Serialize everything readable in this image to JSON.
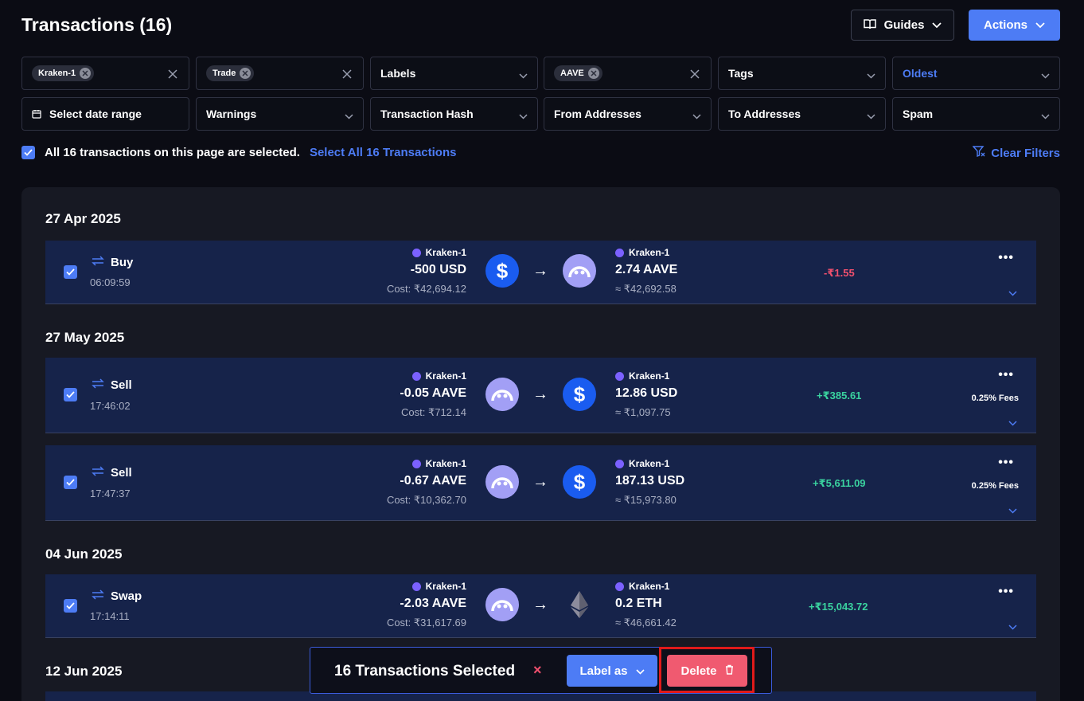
{
  "header": {
    "title": "Transactions (16)",
    "guides_label": "Guides",
    "actions_label": "Actions"
  },
  "filters": {
    "exchange_chip": "Kraken-1",
    "type_chip": "Trade",
    "labels": "Labels",
    "asset_chip": "AAVE",
    "tags": "Tags",
    "sort": "Oldest",
    "date_range": "Select date range",
    "warnings": "Warnings",
    "tx_hash": "Transaction Hash",
    "from_addresses": "From Addresses",
    "to_addresses": "To Addresses",
    "spam": "Spam"
  },
  "selection": {
    "text": "All 16 transactions on this page are selected.",
    "select_all_link": "Select All 16 Transactions",
    "clear_filters": "Clear Filters"
  },
  "groups": [
    {
      "date": "27 Apr 2025",
      "rows": [
        {
          "type": "Buy",
          "time": "06:09:59",
          "from_src": "Kraken-1",
          "from_amount": "-500 USD",
          "from_cost": "Cost: ₹42,694.12",
          "to_src": "Kraken-1",
          "to_amount": "2.74 AAVE",
          "to_value": "≈ ₹42,692.58",
          "pnl": "-₹1.55",
          "fees": ""
        }
      ]
    },
    {
      "date": "27 May 2025",
      "rows": [
        {
          "type": "Sell",
          "time": "17:46:02",
          "from_src": "Kraken-1",
          "from_amount": "-0.05 AAVE",
          "from_cost": "Cost: ₹712.14",
          "to_src": "Kraken-1",
          "to_amount": "12.86 USD",
          "to_value": "≈ ₹1,097.75",
          "pnl": "+₹385.61",
          "fees": "0.25% Fees"
        },
        {
          "type": "Sell",
          "time": "17:47:37",
          "from_src": "Kraken-1",
          "from_amount": "-0.67 AAVE",
          "from_cost": "Cost: ₹10,362.70",
          "to_src": "Kraken-1",
          "to_amount": "187.13 USD",
          "to_value": "≈ ₹15,973.80",
          "pnl": "+₹5,611.09",
          "fees": "0.25% Fees"
        }
      ]
    },
    {
      "date": "04 Jun 2025",
      "rows": [
        {
          "type": "Swap",
          "time": "17:14:11",
          "from_src": "Kraken-1",
          "from_amount": "-2.03 AAVE",
          "from_cost": "Cost: ₹31,617.69",
          "to_src": "Kraken-1",
          "to_amount": "0.2 ETH",
          "to_value": "≈ ₹46,661.42",
          "pnl": "+₹15,043.72",
          "fees": ""
        }
      ]
    },
    {
      "date": "12 Jun 2025",
      "rows": []
    }
  ],
  "bulk_bar": {
    "text": "16 Transactions Selected",
    "close": "×",
    "label_as": "Label as",
    "delete": "Delete"
  },
  "colors": {
    "accent": "#4d7cf5",
    "negative": "#f0506e",
    "positive": "#3ad29f",
    "delete": "#f05a70",
    "row_bg": "#16234a"
  },
  "icons": [
    "book-icon",
    "chevron-down-icon",
    "close-icon",
    "calendar-icon",
    "checkbox-icon",
    "swap-arrows-icon",
    "kraken-icon",
    "usd-coin-icon",
    "aave-coin-icon",
    "eth-coin-icon",
    "arrow-right-icon",
    "more-icon",
    "filter-clear-icon",
    "trash-icon"
  ]
}
